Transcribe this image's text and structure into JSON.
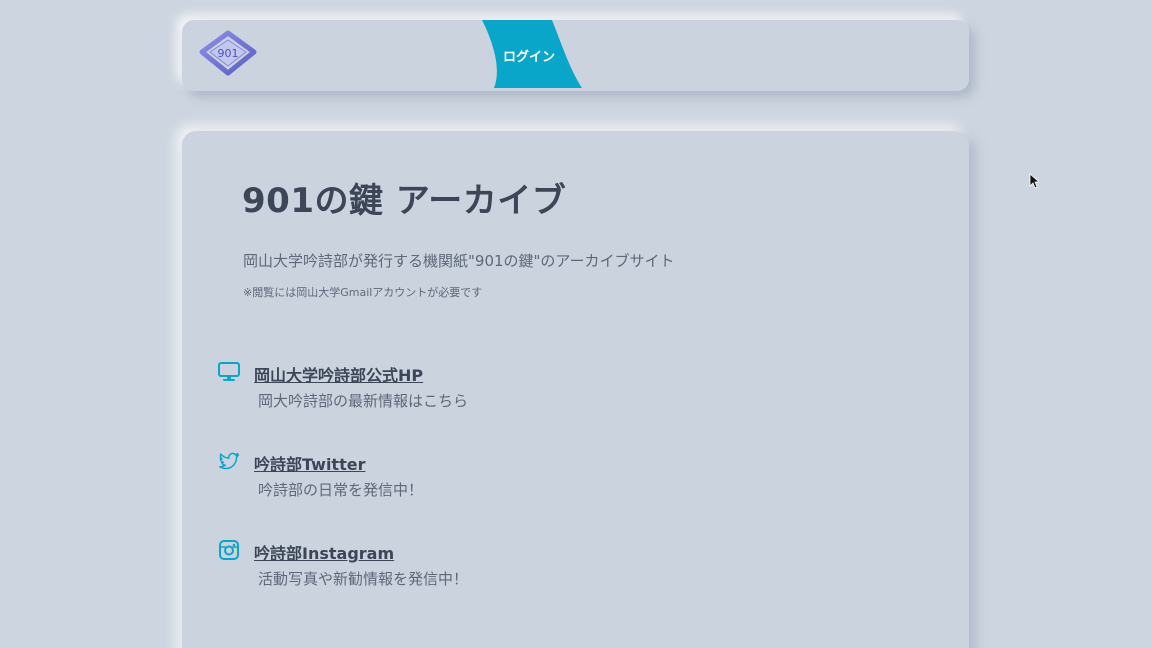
{
  "header": {
    "logo_text": "901",
    "login_label": "ログイン"
  },
  "main": {
    "title": "901の鍵 アーカイブ",
    "subtitle": "岡山大学吟詩部が発行する機関紙\"901の鍵\"のアーカイブサイト",
    "note": "※閲覧には岡山大学Gmailアカウントが必要です",
    "links": [
      {
        "icon": "monitor-icon",
        "label": "岡山大学吟詩部公式HP",
        "description": "岡大吟詩部の最新情報はこちら"
      },
      {
        "icon": "twitter-icon",
        "label": "吟詩部Twitter",
        "description": "吟詩部の日常を発信中！"
      },
      {
        "icon": "instagram-icon",
        "label": "吟詩部Instagram",
        "description": "活動写真や新勧情報を発信中！"
      }
    ]
  },
  "colors": {
    "background": "#cdd5e0",
    "accent": "#0aa6c9",
    "text_dark": "#3c4656",
    "text_muted": "#5e6878",
    "logo": "#6f73d2"
  }
}
